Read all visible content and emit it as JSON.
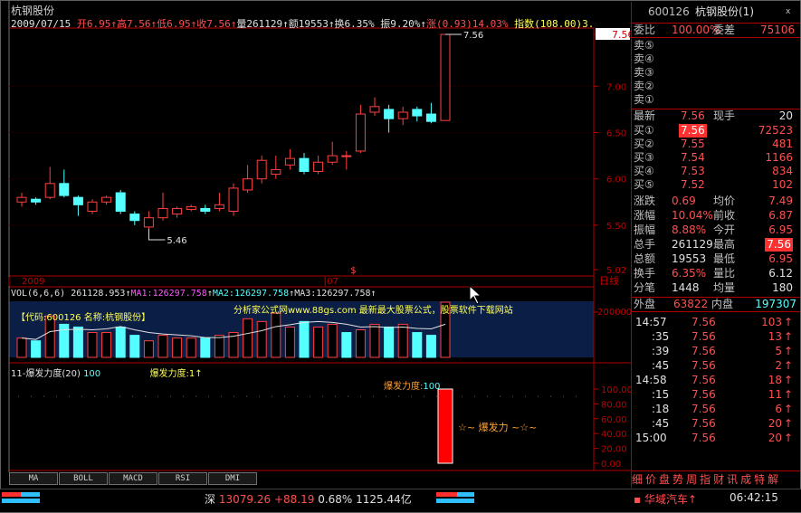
{
  "stock": {
    "name": "杭钢股份",
    "date": "2009/07/15",
    "open_label": "开",
    "open": "6.95",
    "high_label": "高",
    "high": "7.56",
    "low_label": "低",
    "low": "6.95",
    "close_label": "收",
    "close": "7.56",
    "vol_label": "量",
    "vol": "261129",
    "amt_label": "额",
    "amt": "19553",
    "turnover_label": "换",
    "turnover": "6.35%",
    "amp_label": "振",
    "amp": "9.20%",
    "change_label": "涨",
    "change": "(0.93)14.03%",
    "index_label": "指数",
    "index": "(108.00)3."
  },
  "price_axis": [
    "7.56",
    "7.00",
    "6.50",
    "6.00",
    "5.50",
    "5.02"
  ],
  "high_marker": "7.56",
  "low_marker": "5.46",
  "time_axis": {
    "year": "2009",
    "month": "07",
    "period_label": "日线",
    "dollar": "$"
  },
  "candles": [
    {
      "o": 5.75,
      "c": 5.8,
      "h": 5.85,
      "l": 5.7
    },
    {
      "o": 5.78,
      "c": 5.75,
      "h": 5.8,
      "l": 5.72
    },
    {
      "o": 5.8,
      "c": 5.95,
      "h": 6.13,
      "l": 5.78
    },
    {
      "o": 5.95,
      "c": 5.82,
      "h": 6.1,
      "l": 5.8
    },
    {
      "o": 5.8,
      "c": 5.72,
      "h": 5.82,
      "l": 5.6
    },
    {
      "o": 5.65,
      "c": 5.75,
      "h": 5.78,
      "l": 5.62
    },
    {
      "o": 5.75,
      "c": 5.8,
      "h": 5.82,
      "l": 5.72
    },
    {
      "o": 5.85,
      "c": 5.65,
      "h": 5.88,
      "l": 5.62
    },
    {
      "o": 5.62,
      "c": 5.55,
      "h": 5.65,
      "l": 5.5
    },
    {
      "o": 5.48,
      "c": 5.58,
      "h": 5.65,
      "l": 5.46
    },
    {
      "o": 5.58,
      "c": 5.68,
      "h": 5.85,
      "l": 5.55
    },
    {
      "o": 5.62,
      "c": 5.68,
      "h": 5.7,
      "l": 5.58
    },
    {
      "o": 5.67,
      "c": 5.7,
      "h": 5.72,
      "l": 5.65
    },
    {
      "o": 5.68,
      "c": 5.65,
      "h": 5.72,
      "l": 5.62
    },
    {
      "o": 5.68,
      "c": 5.72,
      "h": 5.85,
      "l": 5.65
    },
    {
      "o": 5.65,
      "c": 5.9,
      "h": 5.95,
      "l": 5.6
    },
    {
      "o": 5.88,
      "c": 6.0,
      "h": 6.15,
      "l": 5.85
    },
    {
      "o": 6.0,
      "c": 6.2,
      "h": 6.25,
      "l": 5.95
    },
    {
      "o": 6.05,
      "c": 6.1,
      "h": 6.25,
      "l": 6.0
    },
    {
      "o": 6.15,
      "c": 6.22,
      "h": 6.32,
      "l": 6.1
    },
    {
      "o": 6.22,
      "c": 6.08,
      "h": 6.28,
      "l": 6.05
    },
    {
      "o": 6.08,
      "c": 6.18,
      "h": 6.25,
      "l": 6.05
    },
    {
      "o": 6.18,
      "c": 6.25,
      "h": 6.4,
      "l": 6.15
    },
    {
      "o": 6.25,
      "c": 6.25,
      "h": 6.3,
      "l": 6.1
    },
    {
      "o": 6.3,
      "c": 6.7,
      "h": 6.8,
      "l": 6.28
    },
    {
      "o": 6.72,
      "c": 6.78,
      "h": 6.88,
      "l": 6.68
    },
    {
      "o": 6.75,
      "c": 6.65,
      "h": 6.8,
      "l": 6.5
    },
    {
      "o": 6.65,
      "c": 6.72,
      "h": 6.78,
      "l": 6.58
    },
    {
      "o": 6.75,
      "c": 6.68,
      "h": 6.78,
      "l": 6.62
    },
    {
      "o": 6.7,
      "c": 6.62,
      "h": 6.82,
      "l": 6.6
    },
    {
      "o": 6.63,
      "c": 7.56,
      "h": 7.56,
      "l": 6.63
    }
  ],
  "vol_panel": {
    "title": "VOL(6,6,6)",
    "vol_value": "261128.953",
    "ma1_label": "MA1:",
    "ma1": "126297.758",
    "ma2_label": "MA2:",
    "ma2": "126297.758",
    "ma3_label": "MA3:",
    "ma3": "126297.758",
    "code_label": "【代码:600126 名称:杭钢股份】",
    "ad_text": "分析家公式网www.88gs.com 最新最大股票公式，股票软件下载网站",
    "axis_label": "200000",
    "bars": [
      0.35,
      0.3,
      0.75,
      0.6,
      0.55,
      0.45,
      0.45,
      0.55,
      0.4,
      0.3,
      0.4,
      0.35,
      0.35,
      0.35,
      0.4,
      0.45,
      0.7,
      0.65,
      0.8,
      0.55,
      0.65,
      0.55,
      0.6,
      0.45,
      0.5,
      0.6,
      0.55,
      0.6,
      0.45,
      0.4,
      1.0
    ],
    "bar_up": [
      1,
      0,
      1,
      0,
      0,
      1,
      1,
      0,
      0,
      1,
      1,
      1,
      1,
      0,
      1,
      1,
      1,
      1,
      1,
      1,
      0,
      1,
      1,
      0,
      1,
      1,
      0,
      1,
      0,
      0,
      1
    ]
  },
  "burst_panel": {
    "title": "11-爆发力度(20)",
    "title_value": "100",
    "line2": "爆发力度:1",
    "label": "爆发力度:",
    "value": "100",
    "arrow_text": "爆发力",
    "axis": [
      "100.00",
      "80.00",
      "60.00",
      "40.00",
      "20.00",
      "0.00"
    ]
  },
  "tabs": [
    "MA",
    "BOLL",
    "MACD",
    "RSI",
    "DMI"
  ],
  "quote": {
    "code": "600126",
    "name": "杭钢股份(1)",
    "ratio_label": "委比",
    "ratio": "100.00%",
    "diff_label": "委差",
    "diff": "75106",
    "sell": [
      {
        "label": "卖⑤",
        "price": "",
        "vol": ""
      },
      {
        "label": "卖④",
        "price": "",
        "vol": ""
      },
      {
        "label": "卖③",
        "price": "",
        "vol": ""
      },
      {
        "label": "卖②",
        "price": "",
        "vol": ""
      },
      {
        "label": "卖①",
        "price": "",
        "vol": ""
      }
    ],
    "last_label": "最新",
    "last": "7.56",
    "hand_label": "现手",
    "hand": "20",
    "buy": [
      {
        "label": "买①",
        "price": "7.56",
        "vol": "72523"
      },
      {
        "label": "买②",
        "price": "7.55",
        "vol": "481"
      },
      {
        "label": "买③",
        "price": "7.54",
        "vol": "1166"
      },
      {
        "label": "买④",
        "price": "7.53",
        "vol": "834"
      },
      {
        "label": "买⑤",
        "price": "7.52",
        "vol": "102"
      }
    ],
    "stats": [
      {
        "l1": "涨跌",
        "v1": "0.69",
        "l2": "均价",
        "v2": "7.49"
      },
      {
        "l1": "涨幅",
        "v1": "10.04%",
        "l2": "前收",
        "v2": "6.87"
      },
      {
        "l1": "振幅",
        "v1": "8.88%",
        "l2": "今开",
        "v2": "6.95"
      },
      {
        "l1": "总手",
        "v1": "261129",
        "l2": "最高",
        "v2": "7.56"
      },
      {
        "l1": "总额",
        "v1": "19553",
        "l2": "最低",
        "v2": "6.95"
      },
      {
        "l1": "换手",
        "v1": "6.35%",
        "l2": "量比",
        "v2": "6.12"
      },
      {
        "l1": "分笔",
        "v1": "1448",
        "l2": "均量",
        "v2": "180"
      }
    ],
    "outer_label": "外盘",
    "outer": "63822",
    "inner_label": "内盘",
    "inner": "197307",
    "ticks": [
      {
        "t": "14:57",
        "p": "7.56",
        "v": "103"
      },
      {
        "t": ":35",
        "p": "7.56",
        "v": "13"
      },
      {
        "t": ":39",
        "p": "7.56",
        "v": "5"
      },
      {
        "t": ":45",
        "p": "7.56",
        "v": "2"
      },
      {
        "t": "14:58",
        "p": "7.56",
        "v": "18"
      },
      {
        "t": ":15",
        "p": "7.56",
        "v": "11"
      },
      {
        "t": ":18",
        "p": "7.56",
        "v": "6"
      },
      {
        "t": ":45",
        "p": "7.56",
        "v": "20"
      },
      {
        "t": "15:00",
        "p": "7.56",
        "v": "20"
      }
    ],
    "bottom_tabs": [
      "细",
      "价",
      "盘",
      "势",
      "周",
      "指",
      "财",
      "讯",
      "成",
      "特",
      "解"
    ]
  },
  "status": {
    "market": "深",
    "index": "13079.26",
    "change": "+88.19",
    "pct": "0.68%",
    "amount": "1125.44亿",
    "news": "华域汽车",
    "time": "06:42:15"
  }
}
